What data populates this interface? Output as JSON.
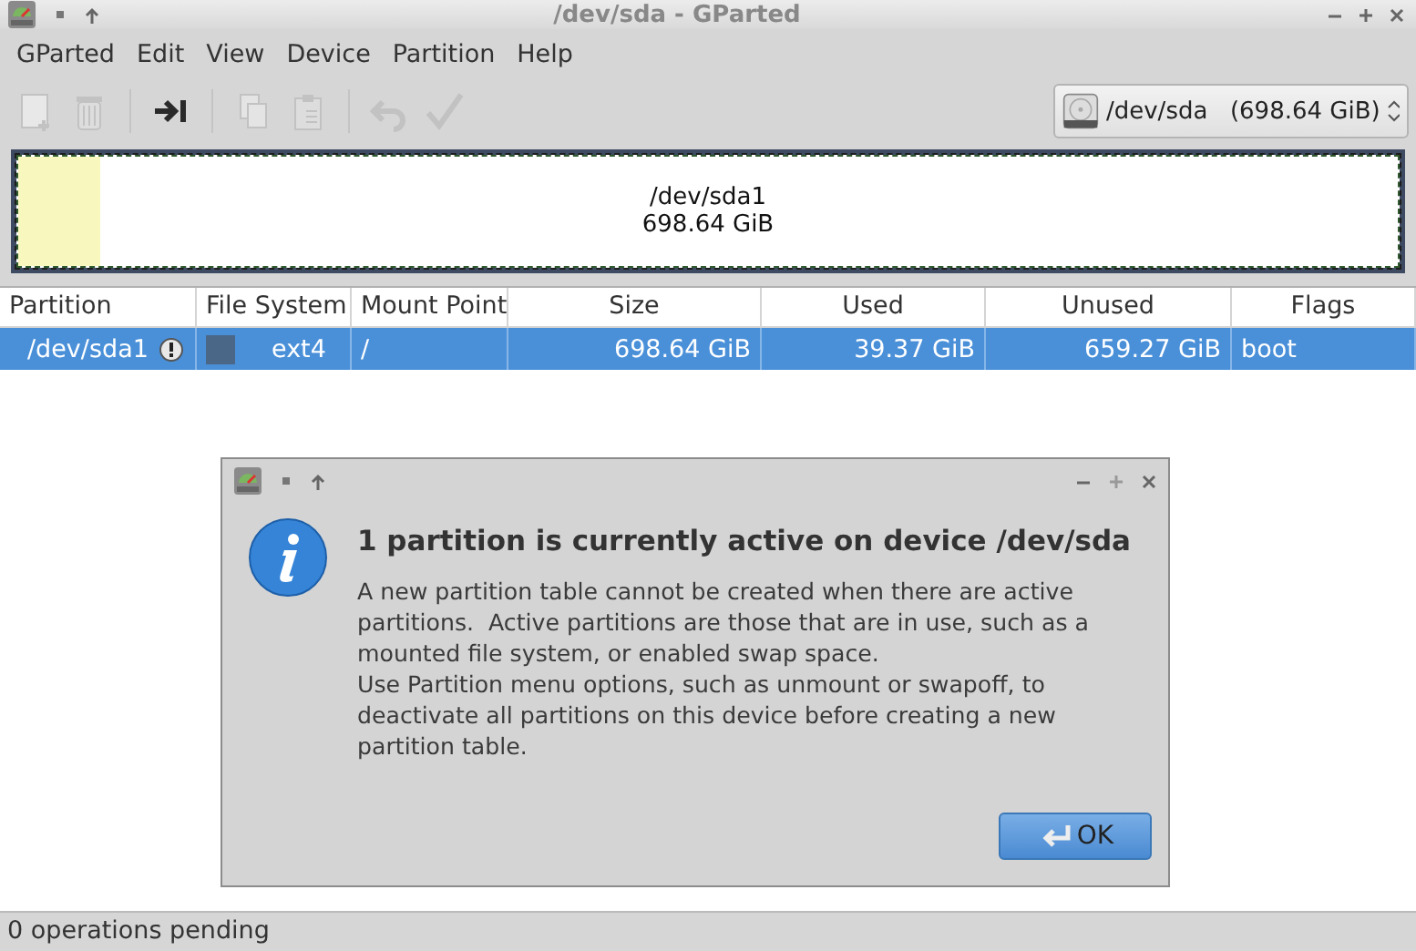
{
  "window": {
    "title": "/dev/sda - GParted"
  },
  "menu": [
    "GParted",
    "Edit",
    "View",
    "Device",
    "Partition",
    "Help"
  ],
  "toolbar": [
    {
      "kind": "new",
      "disabled": true
    },
    {
      "kind": "delete",
      "disabled": true
    },
    {
      "kind": "sep"
    },
    {
      "kind": "resize",
      "disabled": false
    },
    {
      "kind": "sep"
    },
    {
      "kind": "copy",
      "disabled": true
    },
    {
      "kind": "paste",
      "disabled": true
    },
    {
      "kind": "sep"
    },
    {
      "kind": "undo",
      "disabled": true
    },
    {
      "kind": "apply",
      "disabled": true
    }
  ],
  "device_selector": {
    "value": "/dev/sda",
    "size": "(698.64 GiB)"
  },
  "disk_map": {
    "name": "/dev/sda1",
    "size": "698.64 GiB",
    "level": 0.06,
    "selected": true
  },
  "table": {
    "columns": [
      "Partition",
      "File System",
      "Mount Point",
      "Size",
      "Used",
      "Unused",
      "Flags"
    ],
    "rows": [
      {
        "partition": "/dev/sda1",
        "active": true,
        "color": "#4a6788",
        "file_system": "ext4",
        "mount_point": "/",
        "size": "698.64 GiB",
        "used": "39.37 GiB",
        "unused": "659.27 GiB",
        "flags": "boot",
        "selected": true
      }
    ]
  },
  "dialog": {
    "heading": "1 partition is currently active on device /dev/sda",
    "paragraphs": [
      "A new partition table cannot be created when there are active partitions.  Active partitions are those that are in use, such as a mounted file system, or enabled swap space.",
      "Use Partition menu options, such as unmount or swapoff, to deactivate all partitions on this device before creating a new partition table."
    ],
    "button": "OK"
  },
  "status_bar": "0 operations pending"
}
